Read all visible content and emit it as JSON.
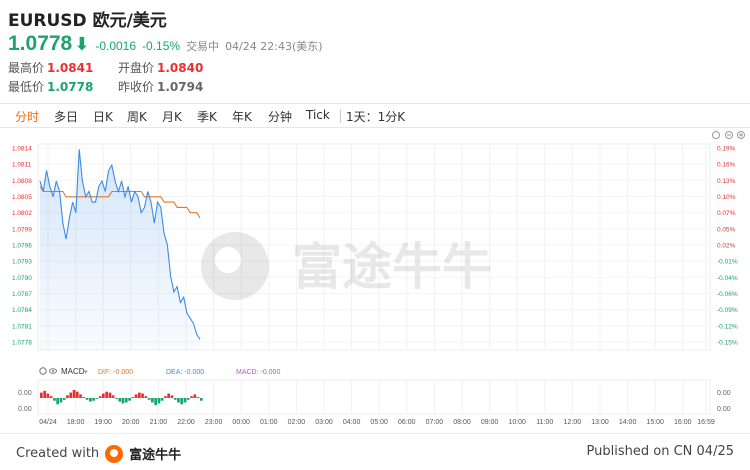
{
  "header": {
    "title": "EURUSD 欧元/美元",
    "price": "1.0778",
    "arrow": "⬇",
    "change": "-0.0016",
    "change_pct": "-0.15%",
    "status": "交易中",
    "datetime": "04/24 22:43(美东)"
  },
  "stats": {
    "high_label": "最高价",
    "high": "1.0841",
    "open_label": "开盘价",
    "open": "1.0840",
    "low_label": "最低价",
    "low": "1.0778",
    "prev_close_label": "昨收价",
    "prev_close": "1.0794"
  },
  "tabs": [
    "分时",
    "多日",
    "日K",
    "周K",
    "月K",
    "季K",
    "年K",
    "分钟",
    "Tick"
  ],
  "tab_range": "1天：1分K",
  "indicator": {
    "name": "MACD",
    "dif": "DIF: -0.000",
    "dea": "DEA: -0.000",
    "macd": "MACD: -0.000"
  },
  "watermark": "富途牛牛",
  "chart_data": {
    "type": "line",
    "y_ticks_left": [
      "1.0814",
      "1.0811",
      "1.0808",
      "1.0805",
      "1.0802",
      "1.0799",
      "1.0796",
      "1.0793",
      "1.0790",
      "1.0787",
      "1.0784",
      "1.0781",
      "1.0778"
    ],
    "y_ticks_right": [
      "0.19%",
      "0.16%",
      "0.13%",
      "0.10%",
      "0.07%",
      "0.05%",
      "0.02%",
      "-0.01%",
      "-0.04%",
      "-0.06%",
      "-0.09%",
      "-0.12%",
      "-0.15%"
    ],
    "x_ticks": [
      "04/24",
      "18:00",
      "19:00",
      "20:00",
      "21:00",
      "22:00",
      "23:00",
      "00:00",
      "01:00",
      "02:00",
      "03:00",
      "04:00",
      "05:00",
      "06:00",
      "07:00",
      "08:00",
      "09:00",
      "10:00",
      "11:00",
      "12:00",
      "13:00",
      "14:00",
      "15:00",
      "16:00",
      "16:59"
    ],
    "macd_y_ticks": [
      "0.00",
      "0.00"
    ],
    "ylim": [
      1.0776,
      1.0815
    ],
    "series": [
      {
        "values": [
          1.0808,
          1.0806,
          1.081,
          1.0807,
          1.0805,
          1.0808,
          1.0806,
          1.08,
          1.0797,
          1.0801,
          1.0804,
          1.0802,
          1.0814,
          1.0808,
          1.0805,
          1.0806,
          1.0804,
          1.0804,
          1.0807,
          1.0808,
          1.0806,
          1.081,
          1.0811,
          1.0808,
          1.0806,
          1.0808,
          1.0805,
          1.0807,
          1.0804,
          1.0806,
          1.0805,
          1.0802,
          1.0803,
          1.0806,
          1.0804,
          1.08,
          1.0804,
          1.0803,
          1.0798,
          1.0796,
          1.079,
          1.0787,
          1.0788,
          1.0785,
          1.0786,
          1.0783,
          1.0782,
          1.0781,
          1.0779,
          1.0778
        ]
      },
      {
        "values": [
          1.0807,
          1.0806,
          1.0806,
          1.0806,
          1.0806,
          1.0806,
          1.0806,
          1.0806,
          1.0805,
          1.0805,
          1.0805,
          1.0805,
          1.0805,
          1.0805,
          1.0805,
          1.0805,
          1.0805,
          1.0805,
          1.0805,
          1.0805,
          1.0805,
          1.0805,
          1.0806,
          1.0806,
          1.0806,
          1.0806,
          1.0806,
          1.0806,
          1.0806,
          1.0806,
          1.0806,
          1.0806,
          1.0805,
          1.0805,
          1.0805,
          1.0805,
          1.0805,
          1.0805,
          1.0804,
          1.0804,
          1.0804,
          1.0804,
          1.0803,
          1.0803,
          1.0803,
          1.0803,
          1.0802,
          1.0802,
          1.0802,
          1.0801
        ]
      }
    ],
    "macd_bars": [
      0.6,
      0.8,
      0.5,
      0.2,
      -0.3,
      -0.7,
      -0.5,
      -0.2,
      0.3,
      0.6,
      0.9,
      0.7,
      0.4,
      0.1,
      -0.2,
      -0.4,
      -0.3,
      -0.1,
      0.2,
      0.5,
      0.7,
      0.6,
      0.3,
      -0.1,
      -0.4,
      -0.6,
      -0.5,
      -0.3,
      0.1,
      0.4,
      0.6,
      0.5,
      0.2,
      -0.2,
      -0.5,
      -0.8,
      -0.6,
      -0.3,
      0.2,
      0.5,
      0.3,
      -0.2,
      -0.5,
      -0.7,
      -0.5,
      -0.2,
      0.2,
      0.4,
      0.1,
      -0.3
    ],
    "colors": {
      "price": "#3b8be8",
      "avg": "#e07a2a",
      "up": "#e93030",
      "down": "#1aa56a"
    }
  },
  "footer": {
    "created_with": "Created with",
    "brand": "富途牛牛",
    "published": "Published on CN 04/25"
  }
}
